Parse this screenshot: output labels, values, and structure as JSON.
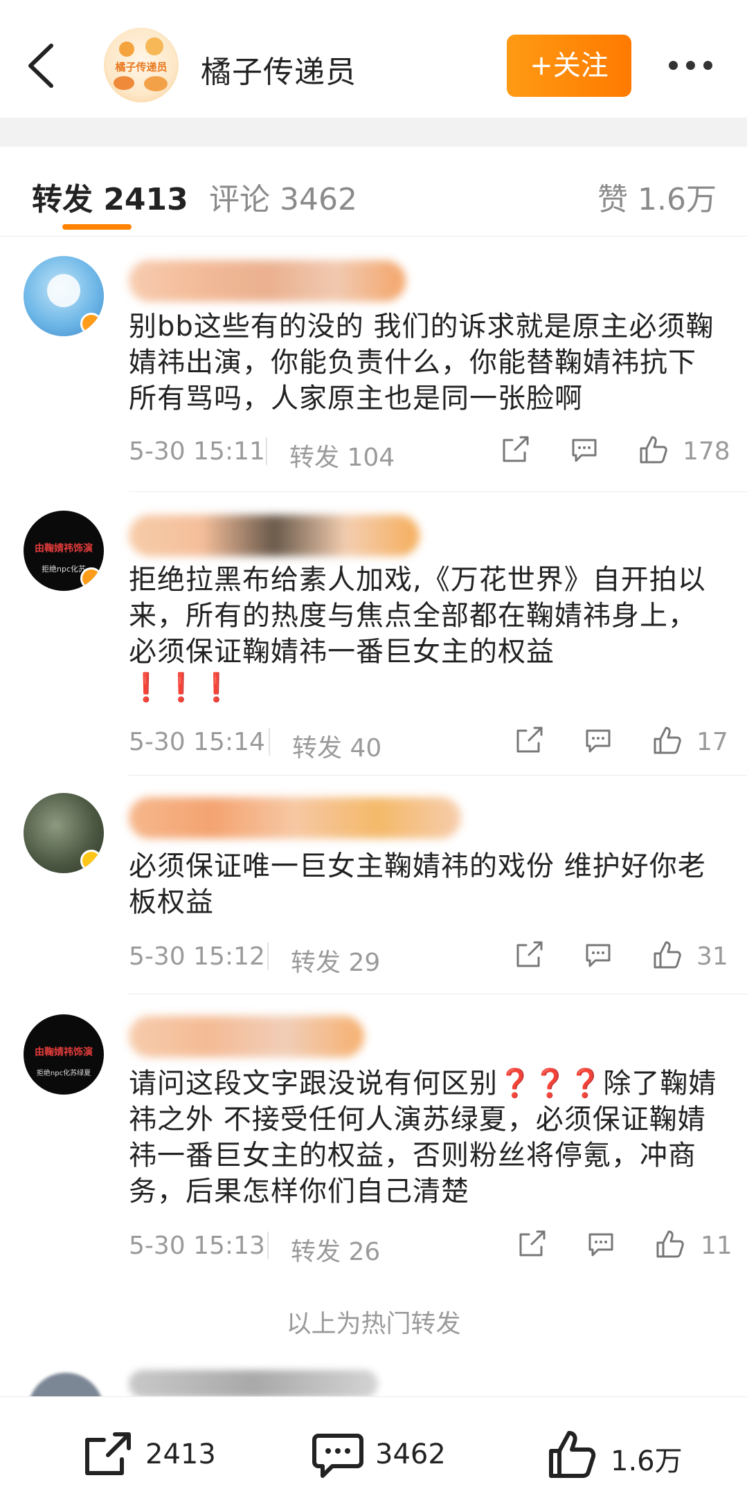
{
  "header": {
    "title": "橘子传递员",
    "avatar_text": "橘子传递员",
    "follow_label": "+关注",
    "follow_color": "#ff8200"
  },
  "tabs": [
    {
      "label": "转发 2413",
      "active": true
    },
    {
      "label": "评论 3462",
      "active": false
    },
    {
      "label": "赞 1.6万",
      "active": false
    }
  ],
  "comments": [
    {
      "text": "别bb这些有的没的 我们的诉求就是原主必须鞠婧祎出演，你能负责什么，你能替鞠婧祎抗下所有骂吗，人家原主也是同一张脸啊",
      "time": "5-30 15:11",
      "repost": "转发 104",
      "likes": "178"
    },
    {
      "text": "拒绝拉黑布给素人加戏,《万花世界》自开拍以来，所有的热度与焦点全部都在鞠婧祎身上，必须保证鞠婧祎一番巨女主的权益",
      "emoji": "❗❗❗",
      "avatar_text": "由鞠婧祎饰演",
      "avatar_subtext": "拒绝npc化苏",
      "time": "5-30 15:14",
      "repost": "转发 40",
      "likes": "17"
    },
    {
      "text": "必须保证唯一巨女主鞠婧祎的戏份 维护好你老板权益",
      "time": "5-30 15:12",
      "repost": "转发 29",
      "likes": "31"
    },
    {
      "text": "请问这段文字跟没说有何区别❓❓❓除了鞠婧祎之外 不接受任何人演苏绿夏，必须保证鞠婧祎一番巨女主的权益，否则粉丝将停氪，冲商务，后果怎样你们自己清楚",
      "avatar_text": "由鞠婧祎饰演",
      "avatar_subtext": "拒绝npc化苏绿夏",
      "time": "5-30 15:13",
      "repost": "转发 26",
      "likes": "11"
    }
  ],
  "hot_label": "以上为热门转发",
  "bottom_bar": {
    "repost_count": "2413",
    "comment_count": "3462",
    "like_count": "1.6万"
  },
  "icons": [
    "back-arrow-icon",
    "more-dots-icon",
    "share-icon",
    "comment-icon",
    "like-icon",
    "verified-badge-icon"
  ]
}
